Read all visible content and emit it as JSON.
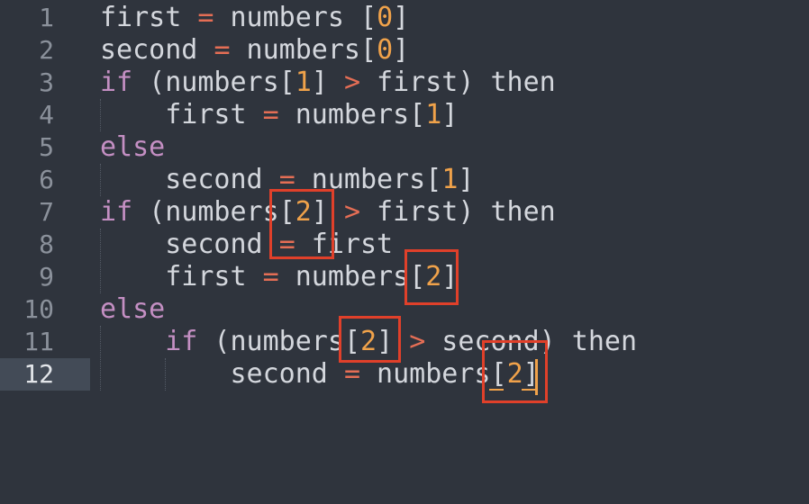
{
  "editor": {
    "line_numbers": [
      "1",
      "2",
      "3",
      "4",
      "5",
      "6",
      "7",
      "8",
      "9",
      "10",
      "11",
      "12"
    ],
    "active_line": "12",
    "lines": [
      [
        {
          "t": "first ",
          "c": ""
        },
        {
          "t": "=",
          "c": "op"
        },
        {
          "t": " numbers [",
          "c": ""
        },
        {
          "t": "0",
          "c": "num"
        },
        {
          "t": "]",
          "c": ""
        }
      ],
      [
        {
          "t": "second ",
          "c": ""
        },
        {
          "t": "=",
          "c": "op"
        },
        {
          "t": " numbers[",
          "c": ""
        },
        {
          "t": "0",
          "c": "num"
        },
        {
          "t": "]",
          "c": ""
        }
      ],
      [
        {
          "t": "if",
          "c": "kw"
        },
        {
          "t": " (numbers[",
          "c": ""
        },
        {
          "t": "1",
          "c": "num"
        },
        {
          "t": "] ",
          "c": ""
        },
        {
          "t": ">",
          "c": "op"
        },
        {
          "t": " first) then",
          "c": ""
        }
      ],
      [
        {
          "t": "    first ",
          "c": ""
        },
        {
          "t": "=",
          "c": "op"
        },
        {
          "t": " numbers[",
          "c": ""
        },
        {
          "t": "1",
          "c": "num"
        },
        {
          "t": "]",
          "c": ""
        }
      ],
      [
        {
          "t": "else",
          "c": "kw"
        }
      ],
      [
        {
          "t": "    second ",
          "c": ""
        },
        {
          "t": "=",
          "c": "op"
        },
        {
          "t": " numbers[",
          "c": ""
        },
        {
          "t": "1",
          "c": "num"
        },
        {
          "t": "]",
          "c": ""
        }
      ],
      [
        {
          "t": "if",
          "c": "kw"
        },
        {
          "t": " (numbers[",
          "c": ""
        },
        {
          "t": "2",
          "c": "num"
        },
        {
          "t": "] ",
          "c": ""
        },
        {
          "t": ">",
          "c": "op"
        },
        {
          "t": " first) then",
          "c": ""
        }
      ],
      [
        {
          "t": "    second ",
          "c": ""
        },
        {
          "t": "=",
          "c": "op"
        },
        {
          "t": " first",
          "c": ""
        }
      ],
      [
        {
          "t": "    first ",
          "c": ""
        },
        {
          "t": "=",
          "c": "op"
        },
        {
          "t": " numbers[",
          "c": ""
        },
        {
          "t": "2",
          "c": "num"
        },
        {
          "t": "]",
          "c": ""
        }
      ],
      [
        {
          "t": "else",
          "c": "kw"
        }
      ],
      [
        {
          "t": "    ",
          "c": ""
        },
        {
          "t": "if",
          "c": "kw"
        },
        {
          "t": " (numbers[",
          "c": ""
        },
        {
          "t": "2",
          "c": "num"
        },
        {
          "t": "] ",
          "c": ""
        },
        {
          "t": ">",
          "c": "op"
        },
        {
          "t": " second) then",
          "c": ""
        }
      ],
      [
        {
          "t": "        second ",
          "c": ""
        },
        {
          "t": "=",
          "c": "op"
        },
        {
          "t": " numbers[",
          "c": ""
        },
        {
          "t": "2",
          "c": "num"
        },
        {
          "t": "]",
          "c": ""
        }
      ]
    ]
  },
  "colors": {
    "background": "#2f343d",
    "text": "#d4d7dd",
    "keyword": "#c48fc3",
    "operator": "#e56e55",
    "number": "#f0a24a",
    "line_number": "#8b919b",
    "active_line_bg": "#434b57",
    "highlight_box": "#e0402a"
  }
}
